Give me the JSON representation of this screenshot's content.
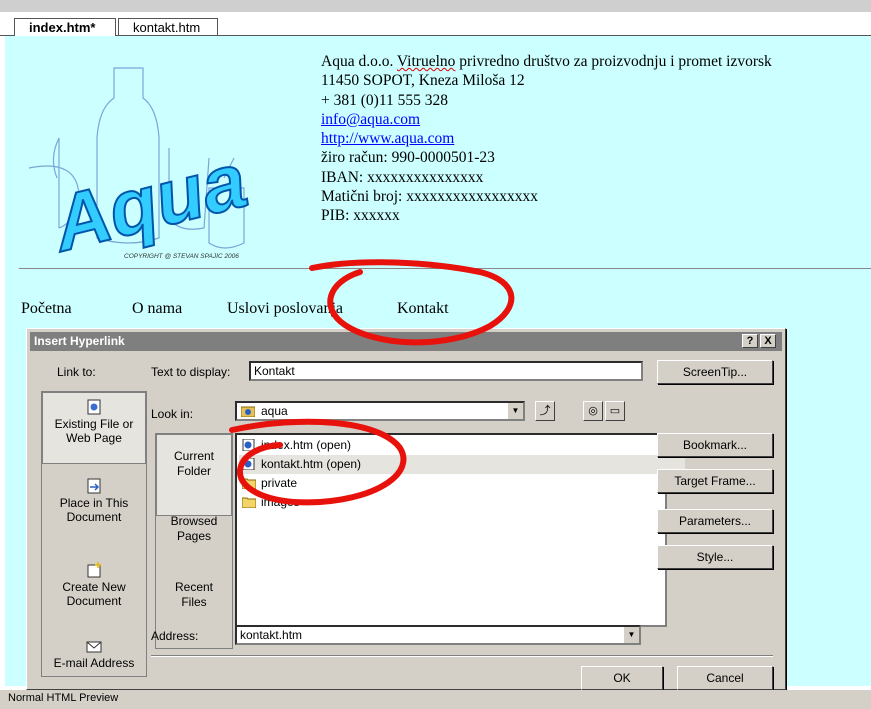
{
  "editor_tabs": [
    {
      "label": "index.htm*"
    },
    {
      "label": "kontakt.htm"
    }
  ],
  "page": {
    "logo_text": "Aqua",
    "logo_copyright": "COPYRIGHT @ STEVAN SPAJIC 2006",
    "company": "Aqua d.o.o. Vitruelno privredno društvo za proizvodnju i promet izvorsk",
    "company_pre": "Aqua  d.o.o. ",
    "company_squig": "Vitruelno",
    "company_post": " privredno društvo za proizvodnju i promet izvorsk",
    "address": "11450 SOPOT, Kneza Miloša 12",
    "phone": "+ 381 (0)11 555 328",
    "email": "info@aqua.com",
    "website": "http://www.aqua.com",
    "account": "žiro račun: 990-0000501-23",
    "iban": "IBAN: xxxxxxxxxxxxxxx",
    "maticni": "Matični broj: xxxxxxxxxxxxxxxxx",
    "pib": "PIB: xxxxxx",
    "nav": [
      "Početna",
      "O nama",
      "Uslovi poslovanja",
      "Kontakt"
    ]
  },
  "dialog": {
    "title": "Insert Hyperlink",
    "help_btn": "?",
    "close_btn": "X",
    "link_to_label": "Link to:",
    "text_to_display_label": "Text to display:",
    "text_to_display_value": "Kontakt",
    "screentip_btn": "ScreenTip...",
    "look_in_label": "Look in:",
    "look_in_value": "aqua",
    "link_targets": [
      {
        "label": "Existing File or Web Page",
        "l1": "Existing File or",
        "l2": "Web Page"
      },
      {
        "label": "Place in This Document",
        "l1": "Place in This",
        "l2": "Document"
      },
      {
        "label": "Create New Document",
        "l1": "Create New",
        "l2": "Document"
      },
      {
        "label": "E-mail Address",
        "l1": "E-mail Address",
        "l2": ""
      }
    ],
    "browse": [
      {
        "l1": "Current",
        "l2": "Folder"
      },
      {
        "l1": "Browsed",
        "l2": "Pages"
      },
      {
        "l1": "Recent",
        "l2": "Files"
      }
    ],
    "files": [
      {
        "name": "index.htm (open)"
      },
      {
        "name": "kontakt.htm (open)"
      },
      {
        "name": "private"
      },
      {
        "name": "images"
      }
    ],
    "side_buttons": [
      "Bookmark...",
      "Target Frame...",
      "Parameters...",
      "Style..."
    ],
    "address_label": "Address:",
    "address_value": "kontakt.htm",
    "ok_btn": "OK",
    "cancel_btn": "Cancel"
  },
  "colors": {
    "page_bg": "#ccffff",
    "annotation": "#e8120c",
    "dialog_bg": "#d4d0c8",
    "title_bar": "#7f7f7f"
  },
  "status_bar": {
    "label": "Normal  HTML  Preview"
  }
}
